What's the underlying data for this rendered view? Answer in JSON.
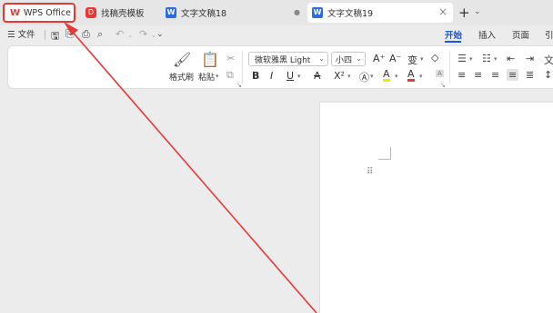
{
  "tabs": {
    "home_label": "WPS Office",
    "home_logo": "W",
    "tab2_label": "找稿壳模板",
    "tab3_label": "文字文稿18",
    "tab4_label": "文字文稿19",
    "word_icon_letter": "W",
    "close_glyph": "×",
    "new_tab_glyph": "+",
    "new_tab_chevron": "⌄"
  },
  "menu": {
    "file_label": "文件",
    "ribbon_tabs": [
      "开始",
      "插入",
      "页面",
      "引"
    ]
  },
  "ribbon": {
    "format_painter_label": "格式刷",
    "paste_label": "粘贴",
    "font_name": "微软雅黑 Light",
    "font_size": "小四",
    "bold": "B",
    "italic": "I",
    "underline": "U",
    "strikethrough": "A",
    "superscript": "X²",
    "phonetic": "变",
    "clear": "◇",
    "font_color_letter": "A",
    "highlight_letter": "A"
  },
  "colors": {
    "accent": "#1a56db",
    "annotation_red": "#e53935",
    "wps_red": "#e53935",
    "word_blue": "#2b6de0"
  }
}
